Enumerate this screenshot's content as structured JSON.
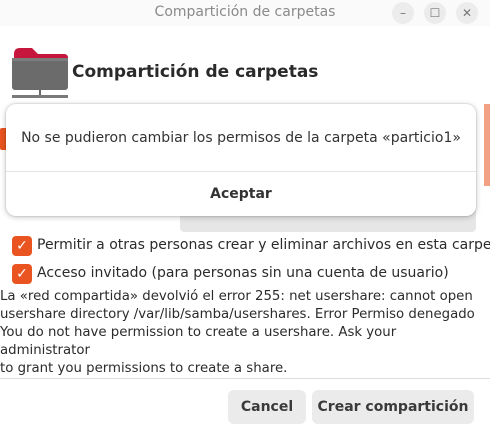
{
  "window": {
    "title": "Compartición de carpetas",
    "controls": {
      "minimize": "–",
      "maximize": "☐",
      "close": "✕"
    }
  },
  "header": {
    "title": "Compartición de carpetas",
    "icon": "folder-share-icon"
  },
  "dialog": {
    "message": "No se pudieron cambiar los permisos de la carpeta «particio1»",
    "accept_label": "Aceptar"
  },
  "options": [
    {
      "label": "Permitir a otras personas crear y eliminar archivos en esta carpeta",
      "checked": true
    },
    {
      "label": "Acceso invitado (para personas sin una cuenta de usuario)",
      "checked": true
    }
  ],
  "error_lines": [
    "La «red compartida» devolvió el error 255: net usershare: cannot open",
    "usershare directory /var/lib/samba/usershares. Error Permiso denegado",
    "You do not have permission to create a usershare. Ask your administrator",
    "to grant you permissions to create a share."
  ],
  "buttons": {
    "cancel": "Cancel",
    "create": "Crear compartición"
  },
  "colors": {
    "accent": "#e95420",
    "folder_tab": "#c7163e",
    "folder_body": "#6b6b6b"
  }
}
